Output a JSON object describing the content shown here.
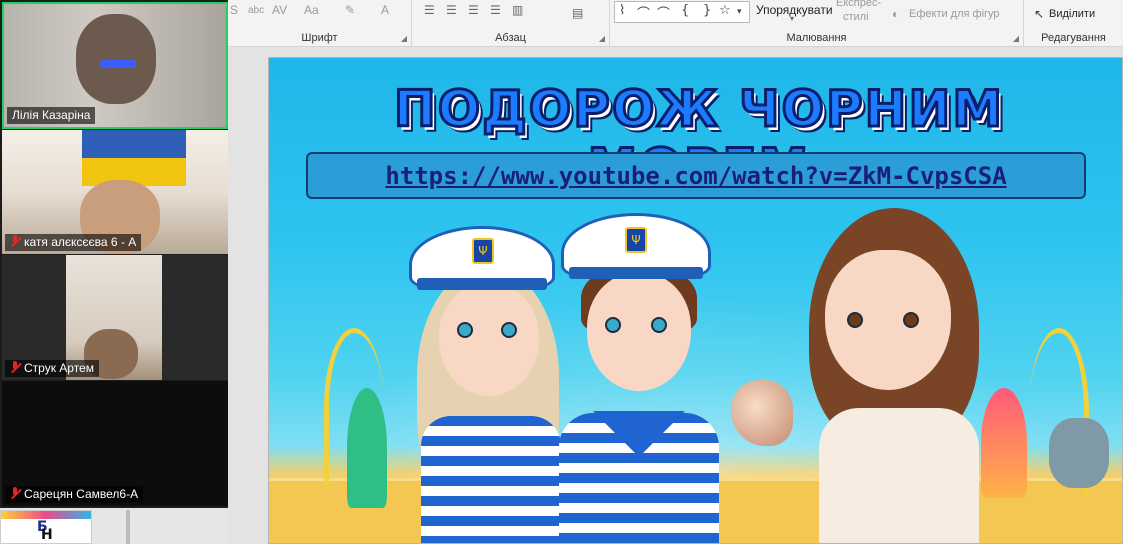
{
  "ribbon": {
    "groups": {
      "font": "Шрифт",
      "paragraph": "Абзац",
      "drawing": "Малювання",
      "editing": "Редагування"
    },
    "tools": {
      "arrange": "Упорядкувати",
      "quick_styles": "Експрес-\nстилі",
      "quick_styles_line1": "Експрес-",
      "quick_styles_line2": "стилі",
      "shape_effects": "Ефекти для фігур",
      "select": "Виділити",
      "format_s": "S",
      "format_abc": "abc",
      "format_av": "AV",
      "format_aa": "Aa",
      "font_color": "A"
    },
    "shape_symbols": [
      "⌇",
      "⌒",
      "⌒",
      "{",
      "}",
      "☆"
    ]
  },
  "slide": {
    "title": "ПОДОРОЖ ЧОРНИМ МОРЕМ",
    "link": "https://www.youtube.com/watch?v=ZkM-CvpsCSA"
  },
  "participants": [
    {
      "name": "Лілія Казаріна",
      "muted": false,
      "active": true
    },
    {
      "name": "катя алєксєєва 6 - А",
      "muted": true,
      "active": false
    },
    {
      "name": "Струк Артем",
      "muted": true,
      "active": false
    },
    {
      "name": "Сарецян Самвел6-А",
      "muted": true,
      "active": false
    }
  ],
  "thumbnail": {
    "letters": [
      "Б",
      "Н"
    ]
  },
  "colors": {
    "active_speaker_border": "#23d160",
    "muted_mic": "#e02828",
    "title_fill": "#1d7bff",
    "link_color": "#1a1e7a"
  },
  "icons": {
    "mic_muted": "mic-off-icon",
    "select_cursor": "cursor-icon",
    "effects": "shape-effects-icon"
  }
}
